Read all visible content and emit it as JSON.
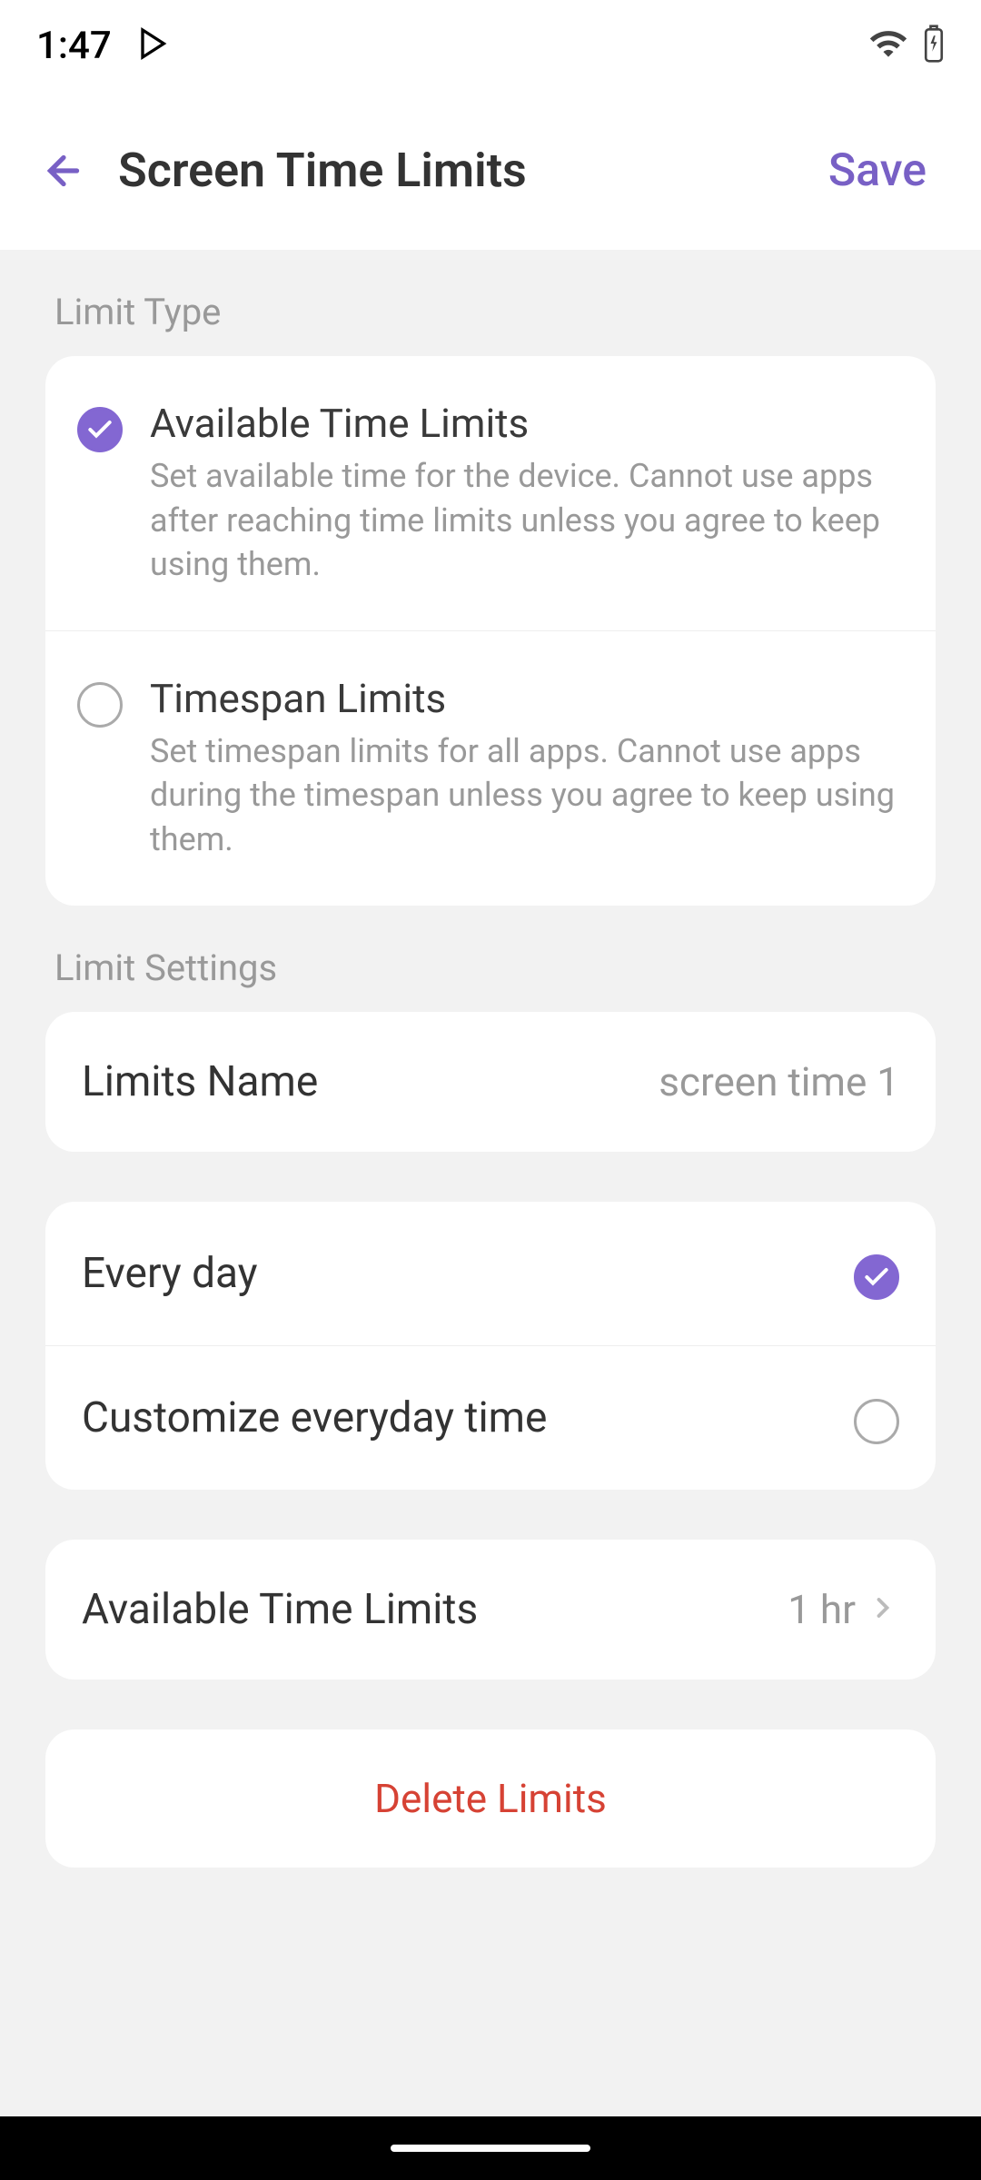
{
  "status": {
    "time": "1:47"
  },
  "header": {
    "title": "Screen Time Limits",
    "save": "Save"
  },
  "sections": {
    "limitType": {
      "header": "Limit Type",
      "options": [
        {
          "title": "Available Time Limits",
          "desc": "Set available time for the device. Cannot use apps after reaching time limits unless you agree to keep using them.",
          "selected": true
        },
        {
          "title": "Timespan Limits",
          "desc": "Set timespan limits for all apps. Cannot use apps during the timespan unless you agree to keep using them.",
          "selected": false
        }
      ]
    },
    "limitSettings": {
      "header": "Limit Settings",
      "nameLabel": "Limits Name",
      "nameValue": "screen time 1",
      "schedule": {
        "everyDay": "Every day",
        "customize": "Customize everyday time"
      },
      "available": {
        "label": "Available Time Limits",
        "value": "1 hr"
      }
    },
    "delete": "Delete Limits"
  }
}
